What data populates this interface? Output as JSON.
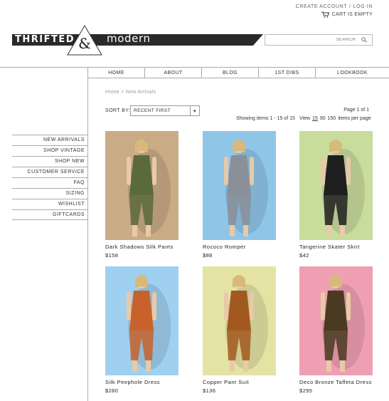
{
  "header": {
    "create_account": "CREATE ACCOUNT",
    "separator": "/",
    "login": "LOG IN",
    "cart_label": "CART IS EMPTY"
  },
  "brand": {
    "left": "THRIFTED",
    "ampersand": "&",
    "right": "modern"
  },
  "search": {
    "placeholder": "SEARCH"
  },
  "nav": [
    "HOME",
    "ABOUT",
    "BLOG",
    "1ST DIBS",
    "LOOKBOOK"
  ],
  "breadcrumb": "Home > New Arrivals",
  "sort": {
    "label": "SORT BY:",
    "selected": "RECENT FIRST"
  },
  "paging": {
    "page_info": "Page 1 of 1",
    "showing": "Showing items 1 - 15 of 15",
    "view_label": "View",
    "view_options": [
      "15",
      "90",
      "150"
    ],
    "per_page_label": "items per page"
  },
  "sidebar": [
    "NEW ARRIVALS",
    "SHOP VINTAGE",
    "SHOP NEW",
    "CUSTOMER SERVICE",
    "FAQ",
    "SIZING",
    "WISHLIST",
    "GIFTCARDS"
  ],
  "products": [
    {
      "name": "Dark Shadows Silk Pants",
      "price": "$158",
      "bg": "#c9ab86",
      "fg": "#5a6a3a"
    },
    {
      "name": "Rococo Romper",
      "price": "$88",
      "bg": "#8fc6e8",
      "fg": "#8a8f98"
    },
    {
      "name": "Tangerine Skater Skirt",
      "price": "$42",
      "bg": "#c8dc9c",
      "fg": "#1e1e1e"
    },
    {
      "name": "Silk Peephole Dress",
      "price": "$280",
      "bg": "#9fd0ef",
      "fg": "#c7622c"
    },
    {
      "name": "Copper Pant Suit",
      "price": "$136",
      "bg": "#e4e3a4",
      "fg": "#a2591f"
    },
    {
      "name": "Deco Bronze Taffeta Dress",
      "price": "$295",
      "bg": "#ef9fb3",
      "fg": "#4a3a22"
    }
  ]
}
